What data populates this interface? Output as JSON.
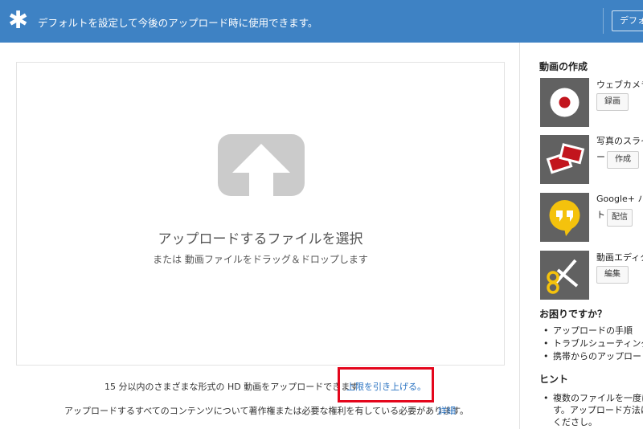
{
  "banner": {
    "text": "デフォルトを設定して今後のアップロード時に使用できます。",
    "button": "デフォ"
  },
  "dropzone": {
    "title": "アップロードするファイルを選択",
    "subtitle": "または 動画ファイルをドラッグ＆ドロップします"
  },
  "limit": {
    "text": "15 分以内のさまざまな形式の HD 動画をアップロードできます",
    "link": "上限を引き上げる。"
  },
  "rights": {
    "text": "アップロードするすべてのコンテンツについて著作権または必要な権利を有している必要があります。",
    "link": "詳細"
  },
  "sidebar": {
    "create_heading": "動画の作成",
    "tools": [
      {
        "label": "ウェブカメラ",
        "line2": "",
        "button": "録画"
      },
      {
        "label": "写真のスライ",
        "line2": "ー",
        "button": "作成"
      },
      {
        "label": "Google+ ハ",
        "line2": "ト",
        "button": "配信"
      },
      {
        "label": "動画エディタ",
        "line2": "",
        "button": "編集"
      }
    ],
    "help_heading": "お困りですか？",
    "help_items": [
      "アップロードの手順",
      "トラブルシューティング",
      "携帯からのアップロード"
    ],
    "hint_heading": "ヒント",
    "hint_text": "複数のファイルを一度にす。アップロード方法にくださし。"
  },
  "colors": {
    "banner": "#3e82c4",
    "link": "#2a73c2",
    "highlight": "#e4061c",
    "tile_bg": "#616161"
  }
}
